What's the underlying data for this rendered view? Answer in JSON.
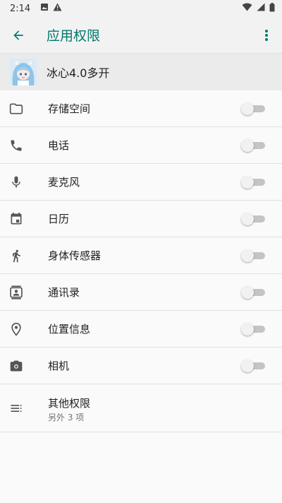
{
  "statusbar": {
    "time": "2:14"
  },
  "appbar": {
    "title": "应用权限"
  },
  "app": {
    "name": "冰心4.0多开"
  },
  "permissions": [
    {
      "label": "存储空间",
      "icon": "folder-icon"
    },
    {
      "label": "电话",
      "icon": "phone-icon"
    },
    {
      "label": "麦克风",
      "icon": "microphone-icon"
    },
    {
      "label": "日历",
      "icon": "calendar-icon"
    },
    {
      "label": "身体传感器",
      "icon": "walk-icon"
    },
    {
      "label": "通讯录",
      "icon": "contacts-icon"
    },
    {
      "label": "位置信息",
      "icon": "location-icon"
    },
    {
      "label": "相机",
      "icon": "camera-icon"
    }
  ],
  "other": {
    "label": "其他权限",
    "sublabel": "另外 3 项",
    "icon": "list-icon"
  },
  "colors": {
    "accent": "#00796b",
    "switch_off_track": "#c4c4c4",
    "switch_off_thumb": "#f1f1f1"
  }
}
